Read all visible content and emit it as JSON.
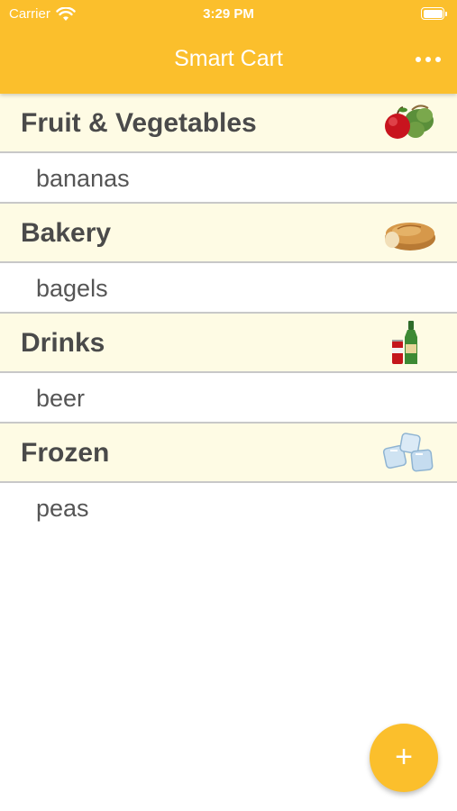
{
  "status_bar": {
    "carrier": "Carrier",
    "time": "3:29 PM"
  },
  "nav": {
    "title": "Smart Cart",
    "more_icon": "ellipsis-icon"
  },
  "sections": [
    {
      "title": "Fruit & Vegetables",
      "icon": "apple-vegetables-icon",
      "items": [
        "bananas"
      ]
    },
    {
      "title": "Bakery",
      "icon": "bread-loaf-icon",
      "items": [
        "bagels"
      ]
    },
    {
      "title": "Drinks",
      "icon": "bottle-can-icon",
      "items": [
        "beer"
      ]
    },
    {
      "title": "Frozen",
      "icon": "ice-cubes-icon",
      "items": [
        "peas"
      ]
    }
  ],
  "fab": {
    "label": "+",
    "icon": "plus-icon"
  },
  "colors": {
    "accent": "#FBBF2C",
    "section_bg": "#FEFBE4",
    "text": "#4a4a4a"
  }
}
